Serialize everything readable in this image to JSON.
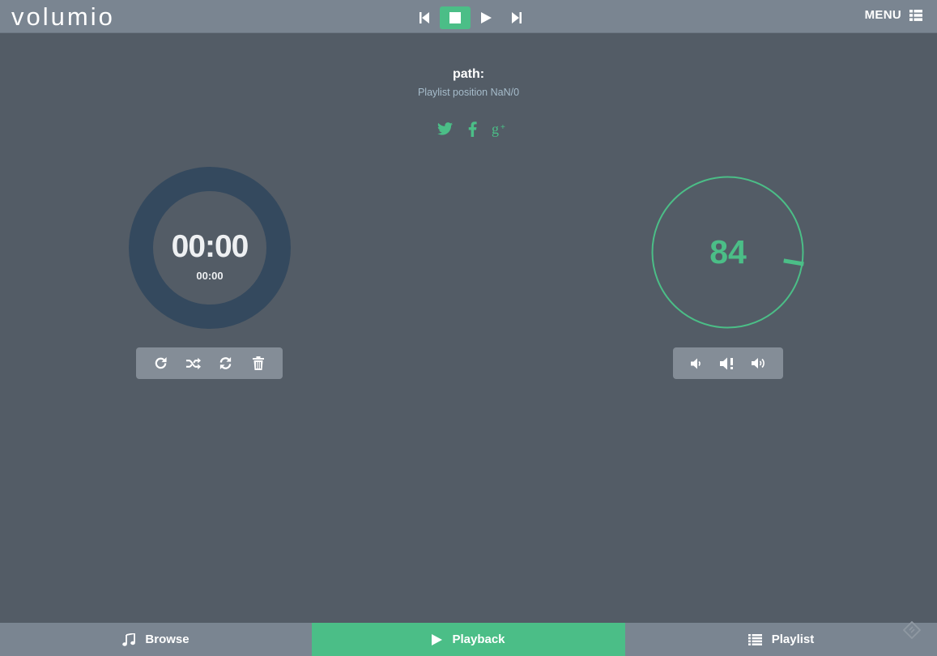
{
  "app": {
    "logo_text": "volumio"
  },
  "header": {
    "transport": {
      "prev_icon": "skip-back-icon",
      "stop_icon": "stop-icon",
      "play_icon": "play-icon",
      "next_icon": "skip-forward-icon",
      "active": "stop"
    },
    "menu_label": "MENU"
  },
  "track": {
    "path_label": "path:",
    "playlist_position": "Playlist position NaN/0"
  },
  "social": [
    "twitter-icon",
    "facebook-icon",
    "google-plus-icon"
  ],
  "time": {
    "elapsed": "00:00",
    "total": "00:00",
    "progress": 0
  },
  "playback_controls": [
    "repeat-icon",
    "shuffle-icon",
    "refresh-icon",
    "trash-icon"
  ],
  "volume": {
    "value": "84",
    "level": 0.84
  },
  "volume_controls": [
    "volume-down-icon",
    "mute-icon",
    "volume-up-icon"
  ],
  "footer": {
    "tabs": [
      {
        "label": "Browse",
        "icon": "music-note-icon"
      },
      {
        "label": "Playback",
        "icon": "play-icon",
        "active": true
      },
      {
        "label": "Playlist",
        "icon": "list-icon"
      }
    ]
  },
  "colors": {
    "accent": "#4bbe87",
    "background": "#535c66",
    "bar": "#7a8591",
    "knob_ring": "#34495e",
    "muted_text": "#a6bccb"
  }
}
